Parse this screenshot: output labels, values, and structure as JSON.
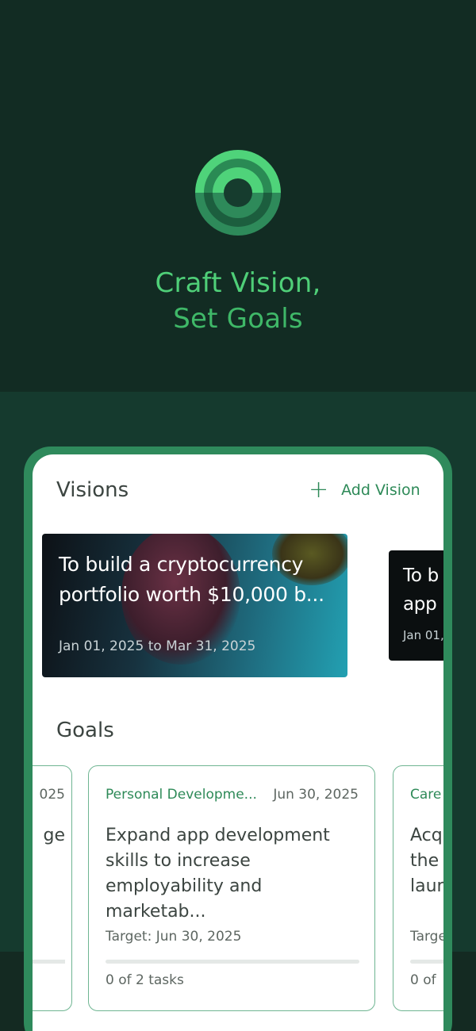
{
  "hero": {
    "line1": "Craft Vision,",
    "line2": "Set Goals"
  },
  "visions": {
    "title": "Visions",
    "add_label": "Add Vision",
    "cards": [
      {
        "title": "To build a cryptocurrency portfolio worth $10,000 b...",
        "dates": "Jan 01, 2025 to Mar 31, 2025"
      },
      {
        "title_partial": "To b",
        "title_partial2": "app",
        "dates_partial": "Jan 01,"
      }
    ]
  },
  "goals": {
    "title": "Goals",
    "left_partial": {
      "date": "025",
      "text": "ge"
    },
    "main": {
      "category": "Personal Developme...",
      "due": "Jun 30, 2025",
      "title": "Expand app development skills to increase employability and marketab...",
      "target": "Target: Jun 30, 2025",
      "tasks": "0 of 2 tasks",
      "progress": 0
    },
    "right_partial": {
      "category": "Care",
      "line1": "Acq",
      "line2": "the",
      "line3": "laun",
      "target": "Targe",
      "tasks": "0 of"
    }
  },
  "colors": {
    "accent": "#2e8a58",
    "headline": "#4fcf78",
    "background": "#122c23"
  }
}
